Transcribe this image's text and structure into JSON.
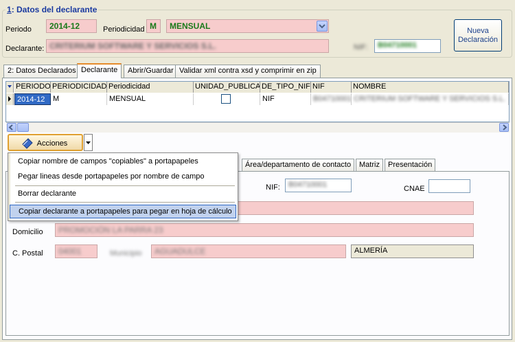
{
  "header": {
    "section_number": "1",
    "section_title": ": Datos del declarante",
    "periodo_label": "Periodo",
    "periodo_value": "2014-12",
    "periodicidad_label": "Periodicidad",
    "periodicidad_code": "M",
    "periodicidad_value": "MENSUAL",
    "declarante_label": "Declarante:",
    "declarante_value": "CRITERIUM SOFTWARE Y SERVICIOS S.L.",
    "nif_label": "NIF:",
    "nif_value": "B04710001",
    "nueva_button": "Nueva\nDeclaración"
  },
  "tabs": [
    "2: Datos Declarados",
    "Declarante",
    "Abrir/Guardar",
    "Validar xml contra xsd y comprimir en zip"
  ],
  "grid": {
    "columns": [
      "PERIODO",
      "PERIODICIDAD",
      "Periodicidad",
      "UNIDAD_PUBLICA",
      "DE_TIPO_NIF",
      "NIF",
      "NOMBRE"
    ],
    "row": {
      "periodo": "2014-12",
      "periodicidad": "M",
      "periodicidad_desc": "MENSUAL",
      "unidad_publica": "",
      "de_tipo_nif": "NIF",
      "nif": "B04710001",
      "nombre": "CRITERIUM SOFTWARE Y SERVICIOS S.L."
    }
  },
  "acciones_button": "Acciones",
  "menu": {
    "items": [
      "Copiar nombre de campos \"copiables\" a portapapeles",
      "Pegar lineas desde portapapeles por nombre de campo",
      "Borrar declarante",
      "Copiar declarante a portapapeles para pegar en hoja de cálculo"
    ]
  },
  "inner_tabs": [
    "Área/departamento de contacto",
    "Matriz",
    "Presentación"
  ],
  "form": {
    "nif_label": "NIF:",
    "nif_value": "B04710001",
    "cnae_label": "CNAE",
    "domicilio_label": "Domicilio",
    "domicilio_value": "PROMOCIÓN LA PARRA 23",
    "cpostal_label": "C. Postal",
    "cpostal_value": "04001",
    "municipio_label": "Municipio",
    "municipio_value": "AGUADULCE",
    "provincia_value": "ALMERÍA"
  },
  "colors": {
    "pink": "#f7cccc",
    "green": "#1a7a1a",
    "selection": "#316ac5"
  }
}
